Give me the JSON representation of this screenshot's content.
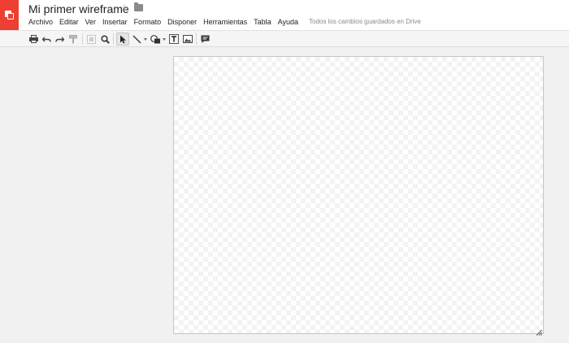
{
  "app": {
    "doc_title": "Mi primer wireframe",
    "save_status": "Todos los cambios guardados en Drive",
    "accent_color": "#ee3f33"
  },
  "menu": [
    {
      "label": "Archivo"
    },
    {
      "label": "Editar"
    },
    {
      "label": "Ver"
    },
    {
      "label": "Insertar"
    },
    {
      "label": "Formato"
    },
    {
      "label": "Disponer"
    },
    {
      "label": "Herramientas"
    },
    {
      "label": "Tabla"
    },
    {
      "label": "Ayuda"
    }
  ],
  "toolbar": {
    "tools": [
      "print-icon",
      "undo-icon",
      "redo-icon",
      "paint-format-icon",
      "fit-icon",
      "zoom-icon",
      "select-icon",
      "line-icon",
      "shape-icon",
      "text-box-icon",
      "image-icon",
      "comment-icon"
    ],
    "active_tool": "select-icon"
  }
}
